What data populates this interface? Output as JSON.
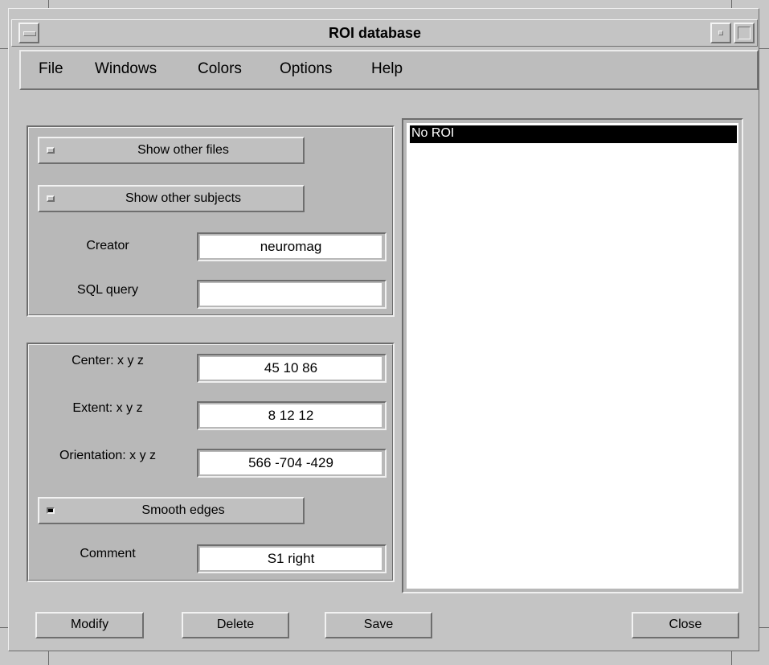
{
  "window": {
    "title": "ROI database"
  },
  "menu": {
    "file": "File",
    "windows": "Windows",
    "colors": "Colors",
    "options": "Options",
    "help": "Help"
  },
  "filter_panel": {
    "show_other_files": {
      "label": "Show other files",
      "checked": false
    },
    "show_other_subjects": {
      "label": "Show other subjects",
      "checked": false
    },
    "creator": {
      "label": "Creator",
      "value": "neuromag"
    },
    "sql_query": {
      "label": "SQL query",
      "value": ""
    }
  },
  "roi_panel": {
    "center": {
      "label": "Center: x y z",
      "value": "45 10 86"
    },
    "extent": {
      "label": "Extent: x y z",
      "value": "8 12 12"
    },
    "orientation": {
      "label": "Orientation: x y z",
      "value": "566 -704 -429"
    },
    "smooth_edges": {
      "label": "Smooth edges",
      "checked": true
    },
    "comment": {
      "label": "Comment",
      "value": "S1 right"
    }
  },
  "roi_list": {
    "items": [
      "No ROI"
    ],
    "selected_index": 0
  },
  "buttons": {
    "modify": "Modify",
    "delete": "Delete",
    "save": "Save",
    "close": "Close"
  }
}
